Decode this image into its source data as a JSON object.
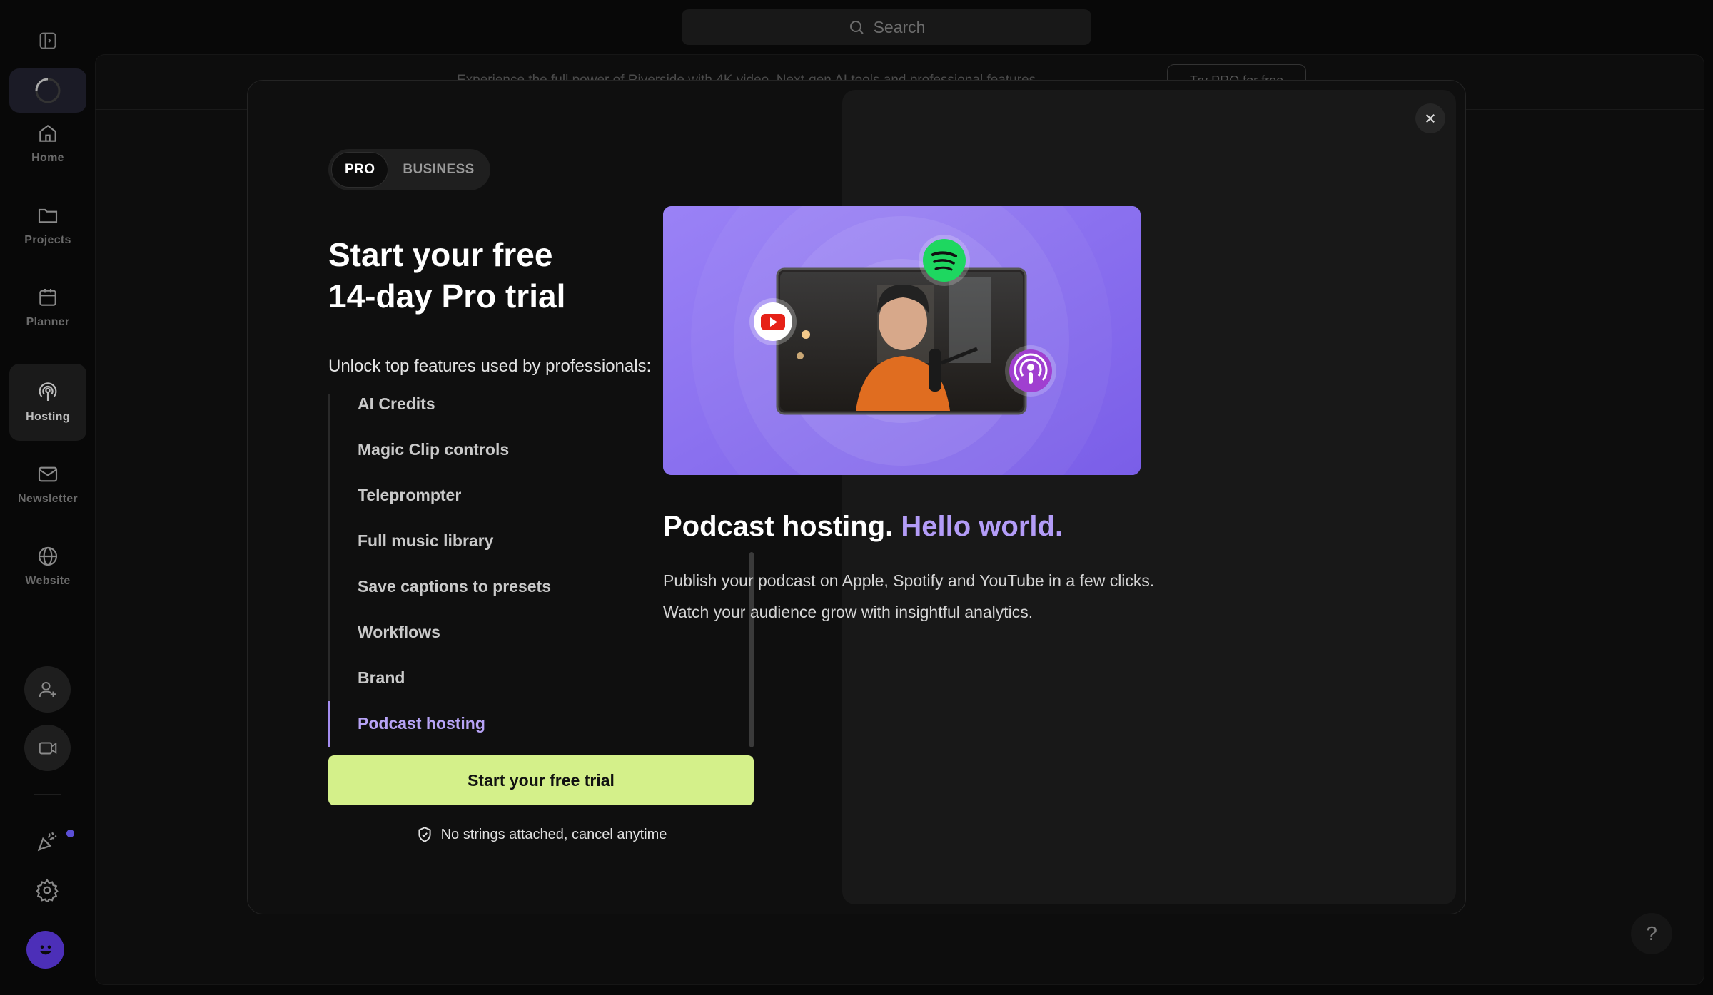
{
  "search": {
    "placeholder": "Search"
  },
  "sidebar": {
    "items": [
      {
        "label": "Home",
        "icon": "home-icon"
      },
      {
        "label": "Projects",
        "icon": "folder-icon"
      },
      {
        "label": "Planner",
        "icon": "calendar-icon"
      },
      {
        "label": "Hosting",
        "icon": "podcast-icon",
        "active": true
      },
      {
        "label": "Newsletter",
        "icon": "mail-icon"
      },
      {
        "label": "Website",
        "icon": "globe-icon"
      }
    ],
    "bottom_icons": [
      "add-user-icon",
      "video-camera-icon",
      "party-popper-icon",
      "gear-icon",
      "avatar"
    ]
  },
  "banner": {
    "text": "Experience the full power of Riverside with 4K video. Next-gen AI tools and professional features.",
    "button_label": "Try PRO for free"
  },
  "modal": {
    "plan_options": [
      "PRO",
      "BUSINESS"
    ],
    "selected_plan": "PRO",
    "headline_line1": "Start your free",
    "headline_line2": "14-day Pro trial",
    "sublead": "Unlock top features used by professionals:",
    "features": [
      "AI Credits",
      "Magic Clip controls",
      "Teleprompter",
      "Full music library",
      "Save captions to presets",
      "Workflows",
      "Brand",
      "Podcast hosting"
    ],
    "active_feature": "Podcast hosting",
    "cta_label": "Start your free trial",
    "guarantee": "No strings attached, cancel anytime",
    "detail": {
      "title": "Podcast hosting.",
      "title_accent": "Hello world.",
      "description": "Publish your podcast on Apple, Spotify and YouTube in a few clicks. Watch your audience grow with insightful analytics."
    }
  },
  "help": {
    "label": "?"
  },
  "colors": {
    "accent_purple": "#b39cf7",
    "cta_green": "#d4f08a",
    "background": "#080808",
    "panel": "#181818"
  }
}
